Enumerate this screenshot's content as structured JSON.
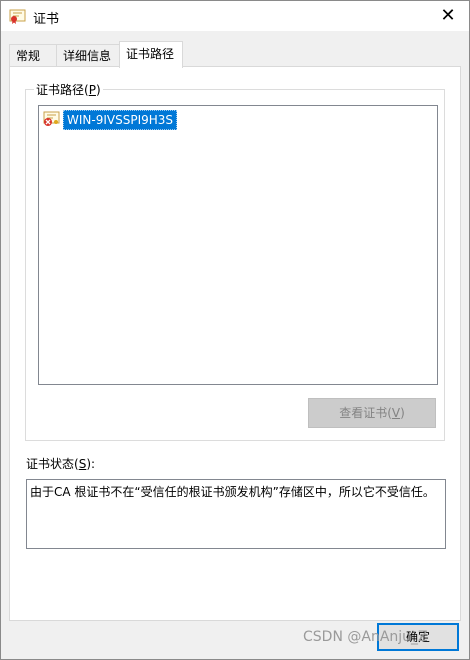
{
  "window": {
    "title": "证书",
    "close_glyph": "✕",
    "icon": "certificate-icon"
  },
  "tabs": [
    {
      "label": "常规",
      "active": false
    },
    {
      "label": "详细信息",
      "active": false
    },
    {
      "label": "证书路径",
      "active": true
    }
  ],
  "cert_path": {
    "group_label_prefix": "证书路径(",
    "group_label_key": "P",
    "group_label_suffix": ")",
    "items": [
      {
        "label": "WIN-9IVSSPI9H3S",
        "icon": "certificate-error-icon",
        "selected": true
      }
    ],
    "view_button_prefix": "查看证书(",
    "view_button_key": "V",
    "view_button_suffix": ")"
  },
  "status": {
    "label_prefix": "证书状态(",
    "label_key": "S",
    "label_suffix": "):",
    "text": "由于CA 根证书不在“受信任的根证书颁发机构”存储区中，所以它不受信任。"
  },
  "footer": {
    "ok_label": "确定"
  },
  "watermark": "CSDN @AnAnju_Z",
  "colors": {
    "selection": "#0078d7",
    "dialog_bg": "#f0f0f0",
    "disabled_button": "#cccccc"
  }
}
